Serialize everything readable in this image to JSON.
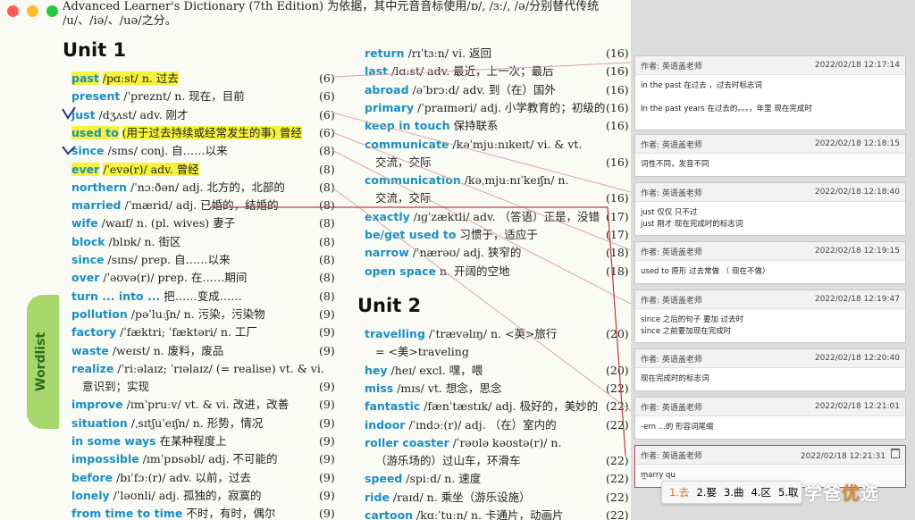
{
  "book": {
    "header_line": "Advanced Learner's Dictionary (7th Edition) 为依据，其中元音音标使用/ɒ/, /ɜː/, /ə/分别替代传统",
    "header_line2": "/u/、/iə/、/uə/之分。",
    "unit1_title": "Unit 1",
    "unit2_title": "Unit 2",
    "side_tab": "Wordlist"
  },
  "col_left": [
    {
      "hw": "past",
      "def": "/pɑːst/ n. 过去",
      "page": "(6)"
    },
    {
      "hw": "present",
      "def": "/ˈpreznt/ n. 现在，目前",
      "page": "(6)"
    },
    {
      "hw": "just",
      "def": "/dʒʌst/ adv. 刚才",
      "page": "(6)"
    },
    {
      "hw": "used to",
      "def": "(用于过去持续或经常发生的事) 曾经",
      "page": "(6)"
    },
    {
      "hw": "since",
      "def": "/sɪns/ conj. 自……以来",
      "page": "(8)"
    },
    {
      "hw": "ever",
      "def": "/ˈevə(r)/ adv. 曾经",
      "page": "(8)"
    },
    {
      "hw": "northern",
      "def": "/ˈnɔːðən/ adj. 北方的，北部的",
      "page": "(8)"
    },
    {
      "hw": "married",
      "def": "/ˈmærid/ adj. 已婚的，结婚的",
      "page": "(8)"
    },
    {
      "hw": "wife",
      "def": "/waɪf/ n. (pl. wives) 妻子",
      "page": "(8)"
    },
    {
      "hw": "block",
      "def": "/blɒk/ n. 街区",
      "page": "(8)"
    },
    {
      "hw": "since",
      "def": "/sɪns/ prep. 自……以来",
      "page": "(8)"
    },
    {
      "hw": "over",
      "def": "/ˈəʊvə(r)/ prep. 在……期间",
      "page": "(8)"
    },
    {
      "hw": "turn ... into ...",
      "def": "把……变成……",
      "page": "(8)"
    },
    {
      "hw": "pollution",
      "def": "/pəˈluːʃn/ n. 污染，污染物",
      "page": "(9)"
    },
    {
      "hw": "factory",
      "def": "/ˈfæktri; ˈfæktəri/ n. 工厂",
      "page": "(9)"
    },
    {
      "hw": "waste",
      "def": "/weɪst/ n. 废料，废品",
      "page": "(9)"
    },
    {
      "hw": "realize",
      "def": "/ˈriːəlaɪz; ˈrɪəlaɪz/ (= realise) vt. & vi.",
      "page": ""
    },
    {
      "hw": "",
      "def": "意识到；实现",
      "page": "(9)"
    },
    {
      "hw": "improve",
      "def": "/ɪmˈpruːv/ vt. & vi. 改进，改善",
      "page": "(9)"
    },
    {
      "hw": "situation",
      "def": "/ˌsɪtʃuˈeɪʃn/ n. 形势，情况",
      "page": "(9)"
    },
    {
      "hw": "in some ways",
      "def": "在某种程度上",
      "page": "(9)"
    },
    {
      "hw": "impossible",
      "def": "/ɪmˈpɒsəbl/ adj. 不可能的",
      "page": "(9)"
    },
    {
      "hw": "before",
      "def": "/bɪˈfɔː(r)/ adv. 以前，过去",
      "page": "(9)"
    },
    {
      "hw": "lonely",
      "def": "/ˈləʊnli/ adj. 孤独的，寂寞的",
      "page": "(9)"
    },
    {
      "hw": "from time to time",
      "def": "不时，有时，偶尔",
      "page": "(9)"
    }
  ],
  "col_right": [
    {
      "hw": "return",
      "def": "/rɪˈtɜːn/ vi. 返回",
      "page": "(16)"
    },
    {
      "hw": "last",
      "def": "/lɑːst/ adv. 最近，上一次；最后",
      "page": "(16)"
    },
    {
      "hw": "abroad",
      "def": "/əˈbrɔːd/ adv. 到（在）国外",
      "page": "(16)"
    },
    {
      "hw": "primary",
      "def": "/ˈpraɪməri/ adj. 小学教育的；初级的",
      "page": "(16)"
    },
    {
      "hw": "keep in touch",
      "def": "保持联系",
      "page": "(16)"
    },
    {
      "hw": "communicate",
      "def": "/kəˈmjuːnɪkeɪt/ vi. & vt.",
      "page": ""
    },
    {
      "hw": "",
      "def": "交流，交际",
      "page": "(16)"
    },
    {
      "hw": "communication",
      "def": "/kəˌmjuːnɪˈkeɪʃn/ n.",
      "page": ""
    },
    {
      "hw": "",
      "def": "交流，交际",
      "page": "(16)"
    },
    {
      "hw": "exactly",
      "def": "/ɪɡˈzæktli/ adv. （答语）正是，没错",
      "page": "(17)"
    },
    {
      "hw": "be/get used to",
      "def": "习惯于，适应于",
      "page": "(17)"
    },
    {
      "hw": "narrow",
      "def": "/ˈnærəʊ/ adj. 狭窄的",
      "page": "(18)"
    },
    {
      "hw": "open space",
      "def": "n. 开阔的空地",
      "page": "(18)"
    }
  ],
  "col_right2": [
    {
      "hw": "travelling",
      "def": "/ˈtrævəlɪŋ/ n. <英>旅行",
      "page": "(20)"
    },
    {
      "hw": "",
      "def": "= <美>traveling",
      "page": ""
    },
    {
      "hw": "hey",
      "def": "/heɪ/ excl. 嘿，喂",
      "page": "(20)"
    },
    {
      "hw": "miss",
      "def": "/mɪs/ vt. 想念，思念",
      "page": "(22)"
    },
    {
      "hw": "fantastic",
      "def": "/fænˈtæstɪk/ adj. 极好的，美妙的",
      "page": "(22)"
    },
    {
      "hw": "indoor",
      "def": "/ˈɪndɔː(r)/ adj. （在）室内的",
      "page": "(22)"
    },
    {
      "hw": "roller coaster",
      "def": "/ˈrəʊlə kəʊstə(r)/ n.",
      "page": ""
    },
    {
      "hw": "",
      "def": "（游乐场的）过山车，环滑车",
      "page": "(22)"
    },
    {
      "hw": "speed",
      "def": "/spiːd/ n. 速度",
      "page": "(22)"
    },
    {
      "hw": "ride",
      "def": "/raɪd/ n. 乘坐（游乐设施）",
      "page": "(22)"
    },
    {
      "hw": "cartoon",
      "def": "/kɑːˈtuːn/ n. 卡通片，动画片",
      "page": "(22)"
    }
  ],
  "comments": [
    {
      "author": "作者: 英语盖老师",
      "time": "2022/02/18 12:17:14",
      "lines": [
        "in the past   在过去 ，过去时标志词",
        "",
        "In the past years   在过去的。。。，年里     现在完成时"
      ]
    },
    {
      "author": "作者: 英语盖老师",
      "time": "2022/02/18 12:18:15",
      "lines": [
        "词性不同，发音不同"
      ]
    },
    {
      "author": "作者: 英语盖老师",
      "time": "2022/02/18 12:18:40",
      "lines": [
        "just  仅仅  只不过",
        "just  刚才    现在完成时的标志词"
      ]
    },
    {
      "author": "作者: 英语盖老师",
      "time": "2022/02/18 12:19:15",
      "lines": [
        "used  to  原形     过去常做    （ 现在不做）"
      ]
    },
    {
      "author": "作者: 英语盖老师",
      "time": "2022/02/18 12:19:47",
      "lines": [
        "since   之后的句子  要加  过去时",
        "since 之前要加现在完成时"
      ]
    },
    {
      "author": "作者: 英语盖老师",
      "time": "2022/02/18 12:20:40",
      "lines": [
        "现在完成时的标志词"
      ]
    },
    {
      "author": "作者: 英语盖老师",
      "time": "2022/02/18 12:21:01",
      "lines": [
        "-ern      ...的     形容词尾缀"
      ]
    },
    {
      "author": "作者: 英语盖老师",
      "time": "2022/02/18 12:21:31",
      "lines": [
        "m̲arry  qu"
      ]
    }
  ],
  "ime": {
    "candidates": [
      "1.去",
      "2.娶",
      "3.曲",
      "4.区",
      "5.取"
    ]
  },
  "watermark": {
    "main": "学爸",
    "accent": "优",
    "tail": "选"
  }
}
